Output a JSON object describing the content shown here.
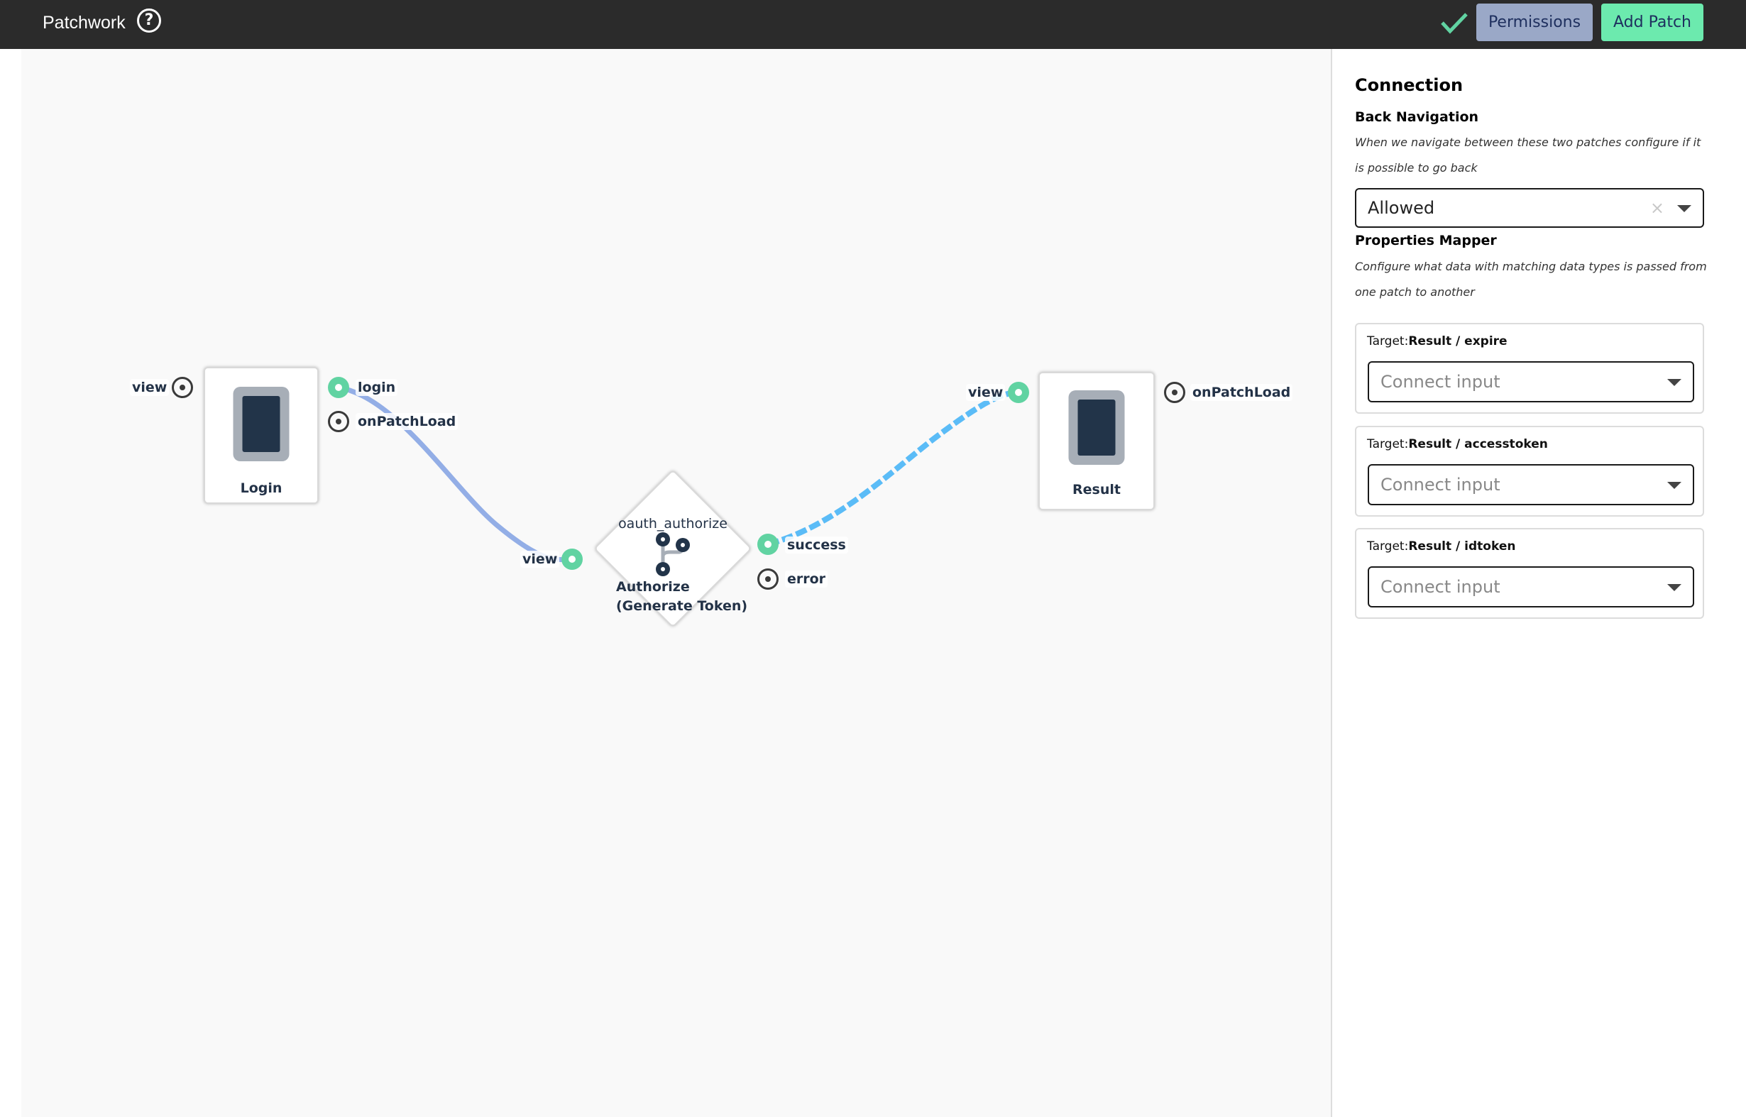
{
  "header": {
    "title": "Patchwork",
    "help_icon": "question-circle-icon",
    "status_icon": "checkmark-icon",
    "permissions_label": "Permissions",
    "add_patch_label": "Add Patch",
    "colors": {
      "bar": "#2b2b2b",
      "check": "#61d3a2",
      "permissions_bg": "#9aa8c7",
      "add_patch_bg": "#6ceaae",
      "button_text": "#1e2f5e"
    }
  },
  "canvas": {
    "nodes": [
      {
        "id": "login",
        "type": "screen",
        "label": "Login",
        "icon": "phone-icon",
        "inputs": [
          {
            "label": "view",
            "state": "open"
          }
        ],
        "outputs": [
          {
            "label": "login",
            "state": "connected"
          },
          {
            "label": "onPatchLoad",
            "state": "open"
          }
        ]
      },
      {
        "id": "authorize",
        "type": "logic",
        "subtitle": "oauth_authorize",
        "label_line1": "Authorize",
        "label_line2": "(Generate Token)",
        "icon": "branch-icon",
        "inputs": [
          {
            "label": "view",
            "state": "connected"
          }
        ],
        "outputs": [
          {
            "label": "success",
            "state": "connected"
          },
          {
            "label": "error",
            "state": "open"
          }
        ]
      },
      {
        "id": "result",
        "type": "screen",
        "label": "Result",
        "icon": "phone-icon",
        "inputs": [
          {
            "label": "view",
            "state": "connected"
          }
        ],
        "outputs": [
          {
            "label": "onPatchLoad",
            "state": "open"
          }
        ]
      }
    ],
    "connections": [
      {
        "from": "Login / login",
        "to": "Authorize (Generate Token) / view",
        "style": "solid",
        "color": "#93aee6"
      },
      {
        "from": "Authorize (Generate Token) / success",
        "to": "Result / view",
        "style": "dashed",
        "selected": true,
        "color": "#5bbcf7"
      }
    ],
    "colors": {
      "background": "#f9f9f9",
      "port_connected": "#61d3a2",
      "node_text": "#233247"
    }
  },
  "panel": {
    "title": "Connection",
    "back_navigation": {
      "title": "Back Navigation",
      "description": "When we navigate between these two patches configure if it is possible to go back",
      "value": "Allowed",
      "clear_icon": "×"
    },
    "properties_mapper": {
      "title": "Properties Mapper",
      "description": "Configure what data with matching data types is passed from one patch to another",
      "target_prefix": "Target:",
      "mappings": [
        {
          "target": "Result / expire",
          "placeholder": "Connect input"
        },
        {
          "target": "Result / accesstoken",
          "placeholder": "Connect input"
        },
        {
          "target": "Result / idtoken",
          "placeholder": "Connect input"
        }
      ]
    }
  }
}
